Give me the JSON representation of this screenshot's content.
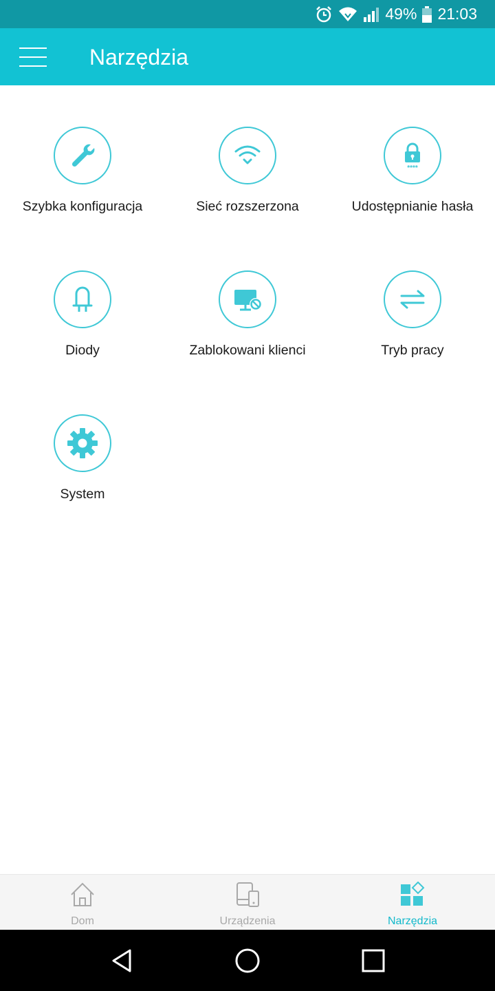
{
  "status_bar": {
    "battery": "49%",
    "time": "21:03",
    "icons": [
      "alarm-icon",
      "wifi-icon",
      "signal-icon",
      "battery-icon"
    ]
  },
  "app_bar": {
    "title": "Narzędzia",
    "menu_icon": "hamburger-menu-icon"
  },
  "tools": [
    {
      "label": "Szybka konfiguracja",
      "icon": "wrench-icon"
    },
    {
      "label": "Sieć rozszerzona",
      "icon": "wifi-extended-icon"
    },
    {
      "label": "Udostępnianie hasła",
      "icon": "password-lock-icon"
    },
    {
      "label": "Diody",
      "icon": "led-icon"
    },
    {
      "label": "Zablokowani klienci",
      "icon": "blocked-monitor-icon"
    },
    {
      "label": "Tryb pracy",
      "icon": "switch-arrows-icon"
    },
    {
      "label": "System",
      "icon": "gear-icon"
    }
  ],
  "bottom_nav": {
    "items": [
      {
        "label": "Dom",
        "icon": "home-icon"
      },
      {
        "label": "Urządzenia",
        "icon": "devices-icon"
      },
      {
        "label": "Narzędzia",
        "icon": "tools-icon",
        "active": true
      }
    ]
  },
  "colors": {
    "status_bar": "#1098a4",
    "accent": "#12c2d3",
    "icon": "#3fc8d6",
    "active_nav": "#12b9cb"
  }
}
